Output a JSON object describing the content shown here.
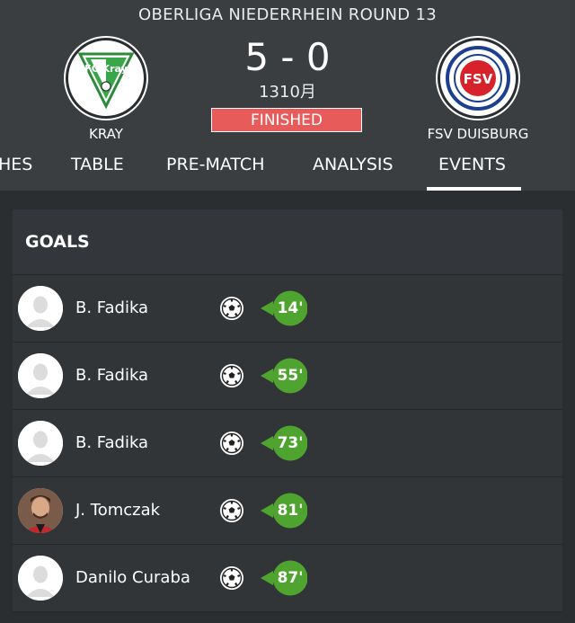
{
  "match": {
    "league_round": "OBERLIGA  NIEDERRHEIN ROUND 13",
    "score": "5 - 0",
    "date": "1310月",
    "status": "FINISHED",
    "status_color": "#e75c5a",
    "home": {
      "name": "KRAY",
      "crest_icon": "fc-kray-crest-icon",
      "crest_text": "FC Kray"
    },
    "away": {
      "name": "FSV DUISBURG",
      "crest_icon": "fsv-duisburg-crest-icon",
      "crest_text": "FSV"
    }
  },
  "tabs": [
    {
      "label": "HES"
    },
    {
      "label": "TABLE"
    },
    {
      "label": "PRE-MATCH"
    },
    {
      "label": "ANALYSIS"
    },
    {
      "label": "EVENTS",
      "active": true
    }
  ],
  "goals": {
    "title": "GOALS",
    "rows": [
      {
        "player": "B. Fadika",
        "minute": "14'",
        "avatar": "placeholder-avatar-icon"
      },
      {
        "player": "B. Fadika",
        "minute": "55'",
        "avatar": "placeholder-avatar-icon"
      },
      {
        "player": "B. Fadika",
        "minute": "73'",
        "avatar": "placeholder-avatar-icon"
      },
      {
        "player": "J. Tomczak",
        "minute": "81'",
        "avatar": "player-photo"
      },
      {
        "player": "Danilo Curaba",
        "minute": "87'",
        "avatar": "placeholder-avatar-icon"
      }
    ]
  },
  "colors": {
    "minute_badge": "#4ea42e",
    "header_bg": "#3b3e41",
    "panel_bg": "#2f3235"
  }
}
